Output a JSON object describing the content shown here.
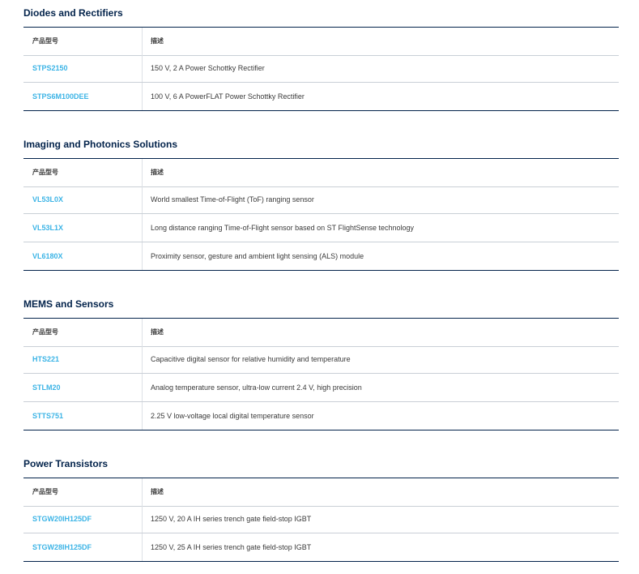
{
  "columns": {
    "part": "产品型号",
    "desc": "描述"
  },
  "sections": [
    {
      "title": "Diodes and Rectifiers",
      "rows": [
        {
          "part": "STPS2150",
          "desc": "150 V, 2 A Power Schottky Rectifier"
        },
        {
          "part": "STPS6M100DEE",
          "desc": "100 V, 6 A PowerFLAT Power Schottky Rectifier"
        }
      ]
    },
    {
      "title": "Imaging and Photonics Solutions",
      "rows": [
        {
          "part": "VL53L0X",
          "desc": "World smallest Time-of-Flight (ToF) ranging sensor"
        },
        {
          "part": "VL53L1X",
          "desc": "Long distance ranging Time-of-Flight sensor based on ST FlightSense technology"
        },
        {
          "part": "VL6180X",
          "desc": "Proximity sensor, gesture and ambient light sensing (ALS) module"
        }
      ]
    },
    {
      "title": "MEMS and Sensors",
      "rows": [
        {
          "part": "HTS221",
          "desc": "Capacitive digital sensor for relative humidity and temperature"
        },
        {
          "part": "STLM20",
          "desc": "Analog temperature sensor, ultra-low current 2.4 V, high precision"
        },
        {
          "part": "STTS751",
          "desc": "2.25 V low-voltage local digital temperature sensor"
        }
      ]
    },
    {
      "title": "Power Transistors",
      "rows": [
        {
          "part": "STGW20IH125DF",
          "desc": "1250 V, 20 A IH series trench gate field-stop IGBT"
        },
        {
          "part": "STGW28IH125DF",
          "desc": "1250 V, 25 A IH series trench gate field-stop IGBT"
        }
      ]
    }
  ]
}
